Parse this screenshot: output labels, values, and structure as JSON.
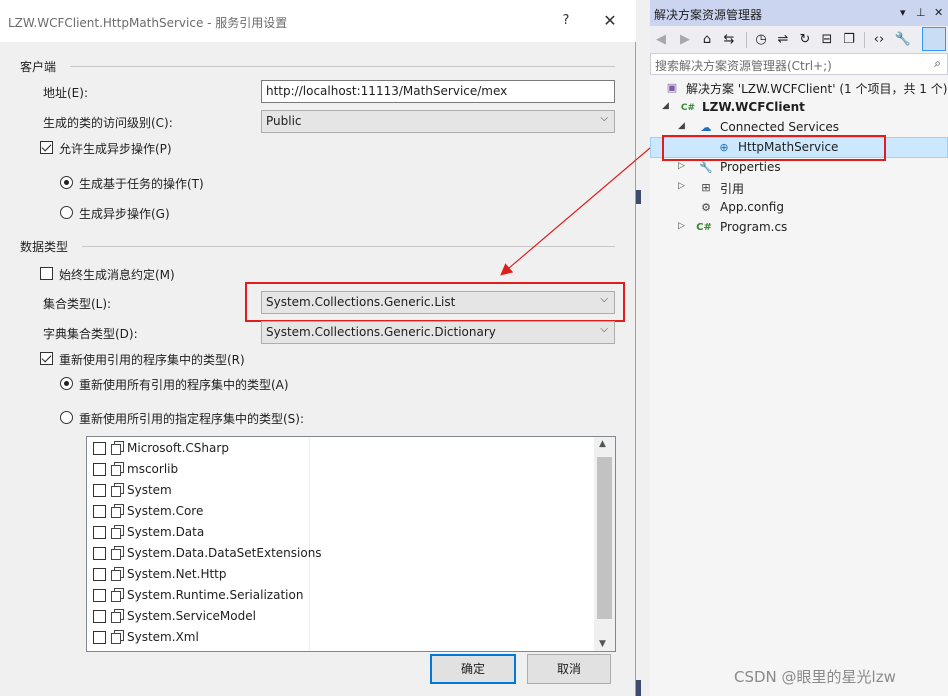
{
  "dialog": {
    "title": "LZW.WCFClient.HttpMathService - 服务引用设置",
    "help_glyph": "?",
    "close_glyph": "✕",
    "client_section": "客户端",
    "address_label": "地址(E):",
    "address_value": "http://localhost:11113/MathService/mex",
    "access_label": "生成的类的访问级别(C):",
    "access_value": "Public",
    "allow_async_label": "允许生成异步操作(P)",
    "allow_async_checked": true,
    "task_based_label": "生成基于任务的操作(T)",
    "async_label": "生成异步操作(G)",
    "data_types_section": "数据类型",
    "always_generate_label": "始终生成消息约定(M)",
    "collection_label": "集合类型(L):",
    "collection_value": "System.Collections.Generic.List",
    "dictionary_label": "字典集合类型(D):",
    "dictionary_value": "System.Collections.Generic.Dictionary",
    "reuse_types_label": "重新使用引用的程序集中的类型(R)",
    "reuse_all_label": "重新使用所有引用的程序集中的类型(A)",
    "reuse_specified_label": "重新使用所引用的指定程序集中的类型(S):",
    "assemblies": [
      "Microsoft.CSharp",
      "mscorlib",
      "System",
      "System.Core",
      "System.Data",
      "System.Data.DataSetExtensions",
      "System.Net.Http",
      "System.Runtime.Serialization",
      "System.ServiceModel",
      "System.Xml"
    ],
    "ok_label": "确定",
    "cancel_label": "取消"
  },
  "explorer": {
    "title": "解决方案资源管理器",
    "search_placeholder": "搜索解决方案资源管理器(Ctrl+;)",
    "solution_label": "解决方案 'LZW.WCFClient' (1 个项目，共 1 个)",
    "project_label": "LZW.WCFClient",
    "connected_services_label": "Connected Services",
    "service_label": "HttpMathService",
    "properties_label": "Properties",
    "references_label": "引用",
    "appconfig_label": "App.config",
    "program_label": "Program.cs"
  },
  "watermark": "CSDN @眼里的星光lzw",
  "colors": {
    "highlight_red": "#e01e1e",
    "selection_blue": "#cce8ff",
    "header_blue": "#ccd5f0",
    "default_button": "#0078d7"
  }
}
